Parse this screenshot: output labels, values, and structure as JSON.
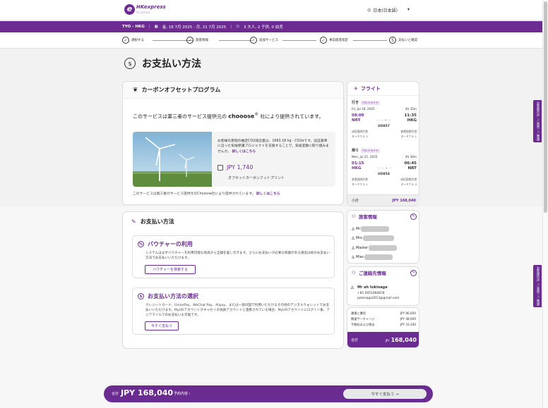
{
  "header": {
    "logo_letter": "e",
    "logo_brand": "HKexpress",
    "logo_sub": "Go Jetstar",
    "language": "日本(日本語)",
    "language_caret": "▾"
  },
  "trip": {
    "route": "TYO - HKG",
    "dates": "金, 18 7月 2025 - 月, 21 7月 2025",
    "passengers": "3 大人, 2 子供, 0 幼児"
  },
  "steps": [
    {
      "label": "選択する",
      "mark": "✓"
    },
    {
      "label": "旅客情報",
      "mark": "✓"
    },
    {
      "label": "追加サービス",
      "mark": "✓"
    },
    {
      "label": "事前座席指定",
      "mark": "✓"
    },
    {
      "label": "支払いと確認",
      "mark": "5"
    }
  ],
  "page": {
    "title": "お支払い方法",
    "title_icon": "$"
  },
  "carbon": {
    "title": "カーボンオフセットプログラム",
    "intro_pre": "このサービスは第三者のサービス提供元の",
    "intro_brand": "chooose",
    "intro_post": "社により提供されています。",
    "description": "お客様の旅程の推定CO2排出量は、1683.18 kg - CO2eです。認証基準に沿った気候保護プロジェクトを支援することで、気候変動に取り組みませんか。",
    "description_link": "詳しくはこちら",
    "price": "JPY 1,740",
    "price_label": "オフセットカーボンフットプリント",
    "footer": "このサービスは第三者のサービス提供元のChooose社により提供されています。",
    "footer_link": "詳しくはこちら"
  },
  "flights": {
    "title": "フライト",
    "outbound": {
      "label": "行き",
      "tag": "ウルトライト",
      "date": "Fri, Jul 18, 2025",
      "duration": "4h 35m",
      "dep_time": "08:00",
      "arr_time": "11:35",
      "from": "NRT",
      "to": "HKG",
      "flight_no": "UO857",
      "dep_airport": "成田国際空港",
      "dep_terminal": "ターミナル 3",
      "arr_airport": "香港国際空港",
      "arr_terminal": "ターミナル 1"
    },
    "inbound": {
      "label": "帰り",
      "tag": "ウルトライト",
      "date": "Mon, Jul 21, 2025",
      "duration": "4h 30m",
      "dep_time": "01:15",
      "arr_time": "06:45",
      "from": "HKG",
      "to": "NRT",
      "flight_no": "UO854",
      "dep_airport": "香港国際空港",
      "dep_terminal": "ターミナル 1",
      "arr_airport": "成田国際空港",
      "arr_terminal": "ターミナル 3"
    },
    "subtotal_label": "小計",
    "subtotal_value": "JPY 168,040"
  },
  "payment": {
    "title": "お支払い方法",
    "voucher": {
      "title": "バウチャーの利用",
      "desc": "システムはまずバウチャーを利用可能な残高から全額を差し引きます。さらにお支払いが必要な残額がある場合は他のお支払い方法でお支払いいただけます。",
      "button": "バウチャーを検索する"
    },
    "method": {
      "title": "お支払い方法の選択",
      "desc": "クレジットカード、UnionPay、WeChat Pay、Alipay、またはー部の国で利用いただけるその他のデジタルウォレットでお支払いいただけます。MyUOアカウントがキャセイの会員アカウントと連携されている場合、MyUOアカウントにログイン後、アジアマイルでのお支払いも可能です。",
      "button": "今すぐ支払う"
    }
  },
  "passengers": {
    "title": "旅客情報",
    "list": [
      {
        "prefix": "Mr"
      },
      {
        "prefix": "Mrs"
      },
      {
        "prefix": "Master"
      },
      {
        "prefix": "Miss"
      }
    ]
  },
  "contact": {
    "title": "ご連絡先情報",
    "name": "Mr ah tokinaga",
    "phone": "+81 0051060878",
    "email": "potenaga2013@gmail.com"
  },
  "summary": {
    "rows": [
      {
        "label": "運賃と費用",
        "value": "JPY 86,600"
      },
      {
        "label": "関連サーチャージ",
        "value": "JPY 48,600"
      },
      {
        "label": "手数料および税金",
        "value": "JPY 33,340"
      }
    ],
    "total_label": "合計",
    "total_currency": "JPY",
    "total_value": "168,040"
  },
  "side_tabs": [
    "お客様の声・ご意見・ご感想",
    "お客様の声・ご意見・ご感想"
  ],
  "bottom": {
    "label": "合計",
    "value": "JPY 168,040",
    "details": "予約内容 ›",
    "pay_button": "今すぐ支払う →"
  },
  "colors": {
    "brand": "#6b2c91",
    "background": "#f2f2f2"
  }
}
